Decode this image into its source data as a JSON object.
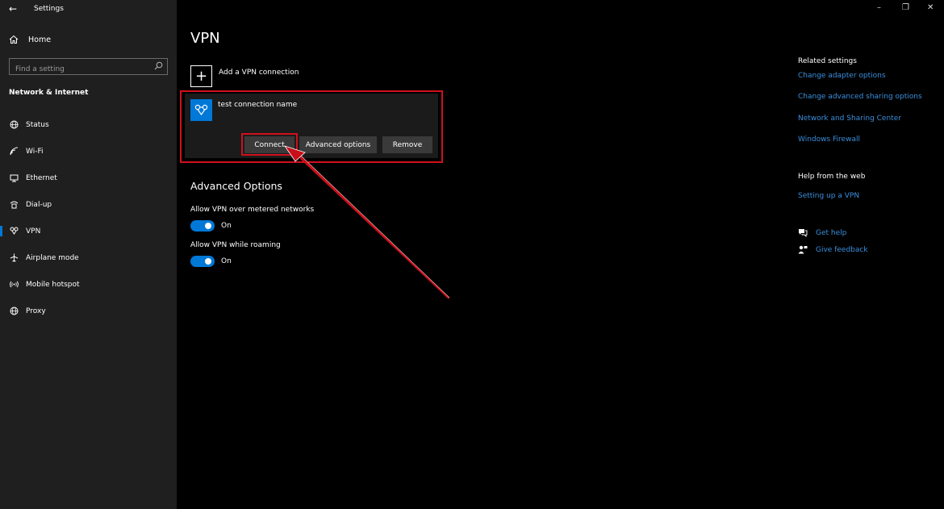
{
  "window": {
    "title": "Settings"
  },
  "sidebar": {
    "home_label": "Home",
    "search_placeholder": "Find a setting",
    "section_title": "Network & Internet",
    "items": [
      {
        "label": "Status",
        "icon": "globe-icon"
      },
      {
        "label": "Wi-Fi",
        "icon": "wifi-icon"
      },
      {
        "label": "Ethernet",
        "icon": "ethernet-icon"
      },
      {
        "label": "Dial-up",
        "icon": "dialup-icon"
      },
      {
        "label": "VPN",
        "icon": "vpn-icon",
        "active": true
      },
      {
        "label": "Airplane mode",
        "icon": "airplane-icon"
      },
      {
        "label": "Mobile hotspot",
        "icon": "hotspot-icon"
      },
      {
        "label": "Proxy",
        "icon": "globe-icon"
      }
    ]
  },
  "main": {
    "title": "VPN",
    "add_connection_label": "Add a VPN connection",
    "connection": {
      "name": "test connection name",
      "buttons": {
        "connect": "Connect",
        "advanced": "Advanced options",
        "remove": "Remove"
      }
    },
    "advanced": {
      "title": "Advanced Options",
      "toggles": [
        {
          "label": "Allow VPN over metered networks",
          "state": "On"
        },
        {
          "label": "Allow VPN while roaming",
          "state": "On"
        }
      ]
    }
  },
  "right": {
    "related_title": "Related settings",
    "related_links": [
      "Change adapter options",
      "Change advanced sharing options",
      "Network and Sharing Center",
      "Windows Firewall"
    ],
    "help_title": "Help from the web",
    "help_links": [
      "Setting up a VPN"
    ],
    "get_help": "Get help",
    "give_feedback": "Give feedback"
  },
  "colors": {
    "accent": "#0078d7",
    "highlight": "#d0101c",
    "link": "#3b8fdd"
  }
}
